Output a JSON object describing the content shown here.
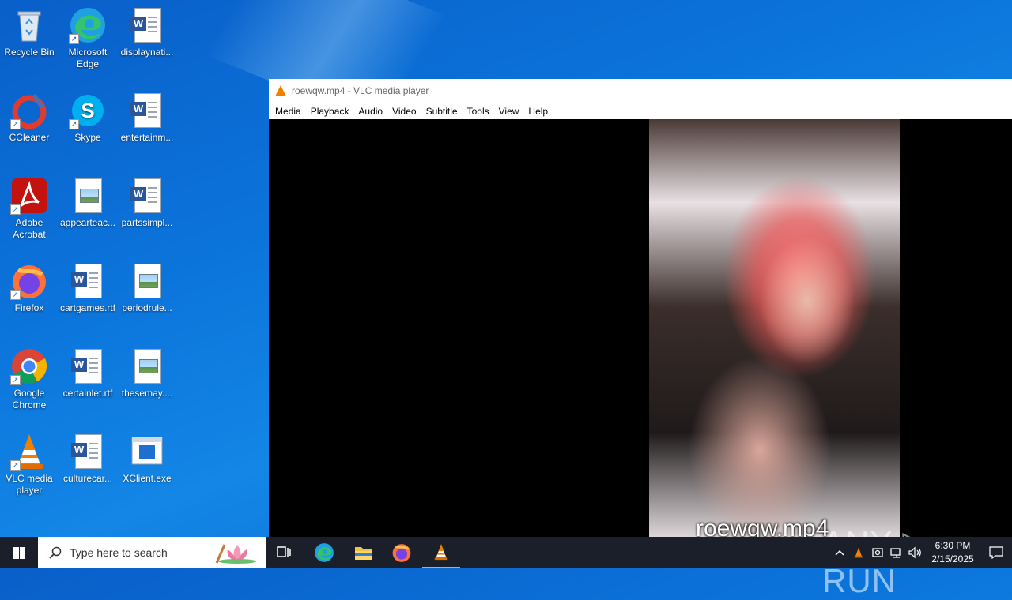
{
  "desktop": {
    "icons": [
      {
        "label": "Recycle Bin",
        "icon": "recycle-bin-icon"
      },
      {
        "label": "Microsoft Edge",
        "icon": "edge-icon"
      },
      {
        "label": "displaynati...",
        "icon": "word-doc-icon"
      },
      {
        "label": "CCleaner",
        "icon": "ccleaner-icon"
      },
      {
        "label": "Skype",
        "icon": "skype-icon"
      },
      {
        "label": "entertainm...",
        "icon": "word-doc-icon"
      },
      {
        "label": "Adobe Acrobat",
        "icon": "acrobat-icon"
      },
      {
        "label": "appearteac...",
        "icon": "image-file-icon"
      },
      {
        "label": "partssimpl...",
        "icon": "word-doc-icon"
      },
      {
        "label": "Firefox",
        "icon": "firefox-icon"
      },
      {
        "label": "cartgames.rtf",
        "icon": "word-doc-icon"
      },
      {
        "label": "periodrule...",
        "icon": "image-file-icon"
      },
      {
        "label": "Google Chrome",
        "icon": "chrome-icon"
      },
      {
        "label": "certainlet.rtf",
        "icon": "word-doc-icon"
      },
      {
        "label": "thesemay....",
        "icon": "image-file-icon"
      },
      {
        "label": "VLC media player",
        "icon": "vlc-icon"
      },
      {
        "label": "culturecar...",
        "icon": "word-doc-icon"
      },
      {
        "label": "XClient.exe",
        "icon": "exe-icon"
      }
    ]
  },
  "vlc": {
    "title": "roewqw.mp4 - VLC media player",
    "menu": [
      "Media",
      "Playback",
      "Audio",
      "Video",
      "Subtitle",
      "Tools",
      "View",
      "Help"
    ],
    "caption": "roewqw.mp4",
    "watermark": "ANY ▷ RUN"
  },
  "taskbar": {
    "search_placeholder": "Type here to search",
    "time": "6:30 PM",
    "date": "2/15/2025"
  },
  "colors": {
    "taskbar": "#1b1f2a",
    "desktop_blue": "#0b74db",
    "vlc_orange": "#f08000"
  }
}
